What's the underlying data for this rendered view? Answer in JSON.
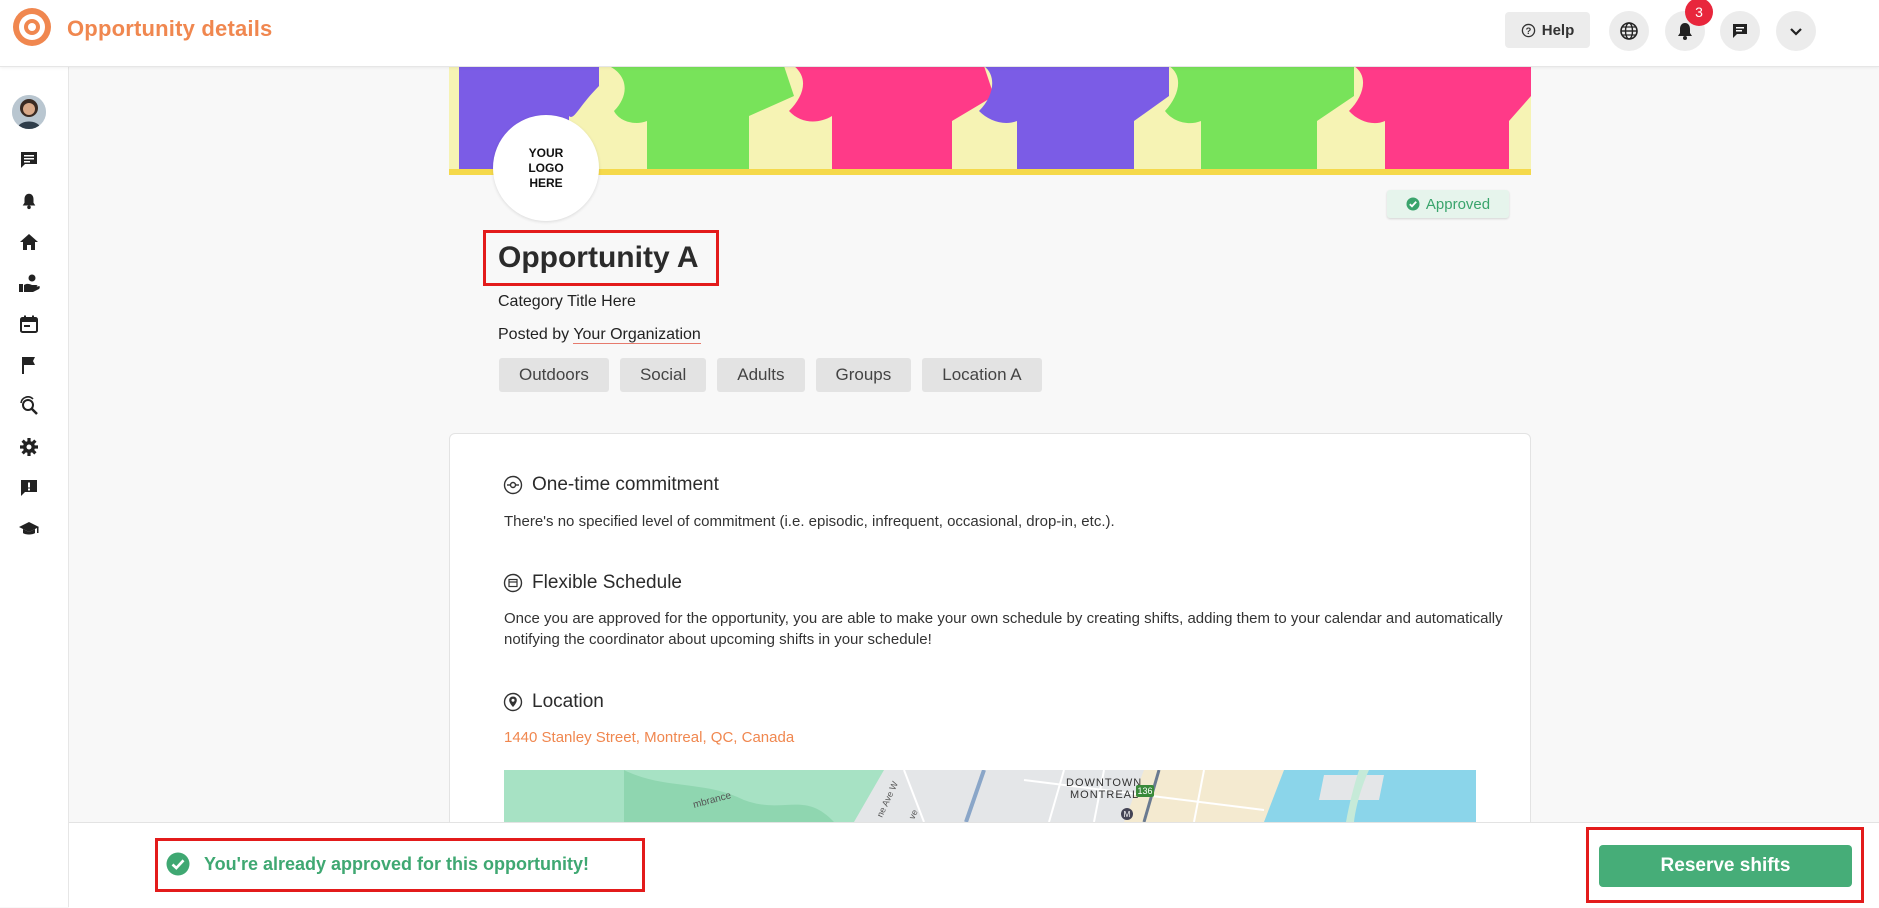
{
  "topbar": {
    "title": "Opportunity details",
    "help_label": "Help",
    "notification_count": "3",
    "icons": [
      "language-icon",
      "bell-icon",
      "chat-icon",
      "chevron-down-icon"
    ]
  },
  "sidebar": {
    "items": [
      "avatar",
      "messages-icon",
      "bell-icon",
      "home-icon",
      "volunteer-hand-icon",
      "calendar-icon",
      "flag-icon",
      "search-refresh-icon",
      "gear-icon",
      "feedback-icon",
      "graduation-cap-icon"
    ]
  },
  "banner": {
    "logo_lines": [
      "YOUR",
      "LOGO",
      "HERE"
    ]
  },
  "opportunity": {
    "status": "Approved",
    "title": "Opportunity A",
    "category": "Category Title Here",
    "posted_by_prefix": "Posted by",
    "organization": "Your Organization",
    "tags": [
      "Outdoors",
      "Social",
      "Adults",
      "Groups",
      "Location A"
    ]
  },
  "details": {
    "commitment_heading": "One-time commitment",
    "commitment_text": "There's no specified level of commitment (i.e. episodic, infrequent, occasional, drop-in, etc.).",
    "schedule_heading": "Flexible Schedule",
    "schedule_text": "Once you are approved for the opportunity, you are able to make your own schedule by creating shifts, adding them to your calendar and automatically notifying the coordinator about upcoming shifts in your schedule!",
    "location_heading": "Location",
    "location_address": "1440 Stanley Street, Montreal, QC, Canada",
    "map_labels": [
      "DOWNTOWN",
      "MONTREAL",
      "136",
      "M",
      "mbrance",
      "ne Ave W",
      "ve"
    ]
  },
  "footer": {
    "approved_message": "You're already approved for this opportunity!",
    "reserve_button": "Reserve shifts"
  },
  "colors": {
    "brand_orange": "#f0874f",
    "success_green": "#46ad78",
    "highlight_red": "#e31b1b",
    "badge_red": "#e8263c"
  }
}
